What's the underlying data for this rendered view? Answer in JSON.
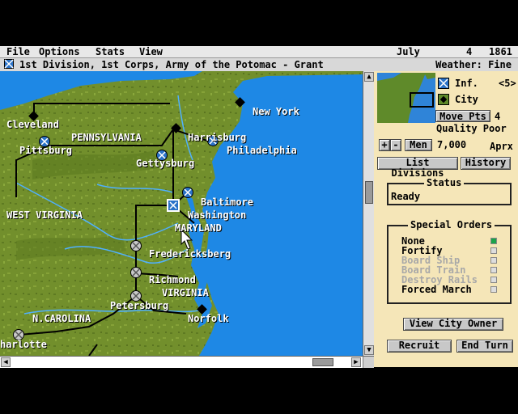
{
  "menu": {
    "items": [
      "File",
      "Options",
      "Stats",
      "View"
    ],
    "date_month": "July",
    "date_day": "4",
    "date_year": "1861"
  },
  "unit_bar": {
    "title": "1st Division, 1st Corps, Army of the Potomac - Grant",
    "weather": "Weather: Fine"
  },
  "map": {
    "labels": {
      "cleveland": "Cleveland",
      "pennsylvania": "PENNSYLVANIA",
      "harrisburg": "Harrisburg",
      "pittsburg": "Pittsburg",
      "philadelphia": "Philadelphia",
      "new_york": "New York",
      "gettysburg": "Gettysburg",
      "baltimore": "Baltimore",
      "washington": "Washington",
      "maryland": "MARYLAND",
      "west_virginia": "WEST VIRGINIA",
      "fredericksberg": "Fredericksberg",
      "richmond": "Richmond",
      "virginia": "VIRGINIA",
      "petersburg": "Petersburg",
      "norfolk": "Norfolk",
      "n_carolina": "N.CAROLINA",
      "charlotte": "harlotte"
    },
    "colors": {
      "sea": "#1e88e5",
      "land": "#6f8d2a",
      "union": "#2a72c8",
      "confederate": "#c8c8c8",
      "city": "#000000"
    }
  },
  "panel": {
    "legend_inf": "Inf.",
    "legend_city": "City",
    "toggle": "<5>",
    "move_pts_label": "Move Pts",
    "move_pts_value": "4",
    "quality": "Quality Poor",
    "plus": "+",
    "minus": "-",
    "men_button": "Men",
    "men_value": "7,000",
    "men_suffix": "Aprx",
    "list_divisions": "List Divisions",
    "history": "History",
    "status_title": "Status",
    "status_value": "Ready",
    "orders_title": "Special Orders",
    "orders": [
      {
        "label": "None",
        "enabled": true,
        "selected": true
      },
      {
        "label": "Fortify",
        "enabled": true,
        "selected": false
      },
      {
        "label": "Board Ship",
        "enabled": false,
        "selected": false
      },
      {
        "label": "Board Train",
        "enabled": false,
        "selected": false
      },
      {
        "label": "Destroy Rails",
        "enabled": false,
        "selected": false
      },
      {
        "label": "Forced March",
        "enabled": true,
        "selected": false
      }
    ],
    "view_city_owner": "View City Owner",
    "recruit": "Recruit",
    "end_turn": "End Turn"
  }
}
